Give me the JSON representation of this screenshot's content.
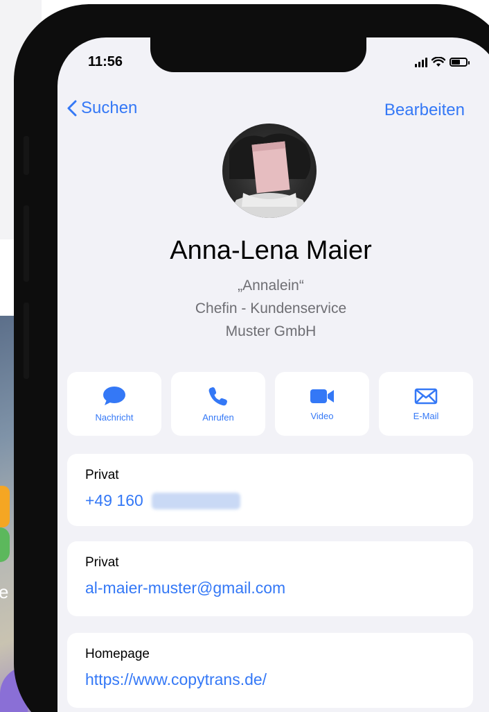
{
  "background": {
    "partial_label": "e"
  },
  "status_bar": {
    "time": "11:56"
  },
  "nav": {
    "back_label": "Suchen",
    "edit_label": "Bearbeiten"
  },
  "contact": {
    "name": "Anna-Lena Maier",
    "nickname": "„Annalein“",
    "job_title": "Chefin - Kundenservice",
    "company": "Muster GmbH"
  },
  "actions": [
    {
      "label": "Nachricht",
      "icon": "message-bubble-icon"
    },
    {
      "label": "Anrufen",
      "icon": "phone-icon"
    },
    {
      "label": "Video",
      "icon": "video-camera-icon"
    },
    {
      "label": "E-Mail",
      "icon": "envelope-icon"
    }
  ],
  "fields": [
    {
      "label": "Privat",
      "value": "+49 160",
      "redacted": true
    },
    {
      "label": "Privat",
      "value": "al-maier-muster@gmail.com"
    },
    {
      "label": "Homepage",
      "value": "https://www.copytrans.de/"
    }
  ],
  "colors": {
    "accent": "#3478f6",
    "screen_bg": "#f2f2f7",
    "secondary_text": "#6e6e73"
  }
}
